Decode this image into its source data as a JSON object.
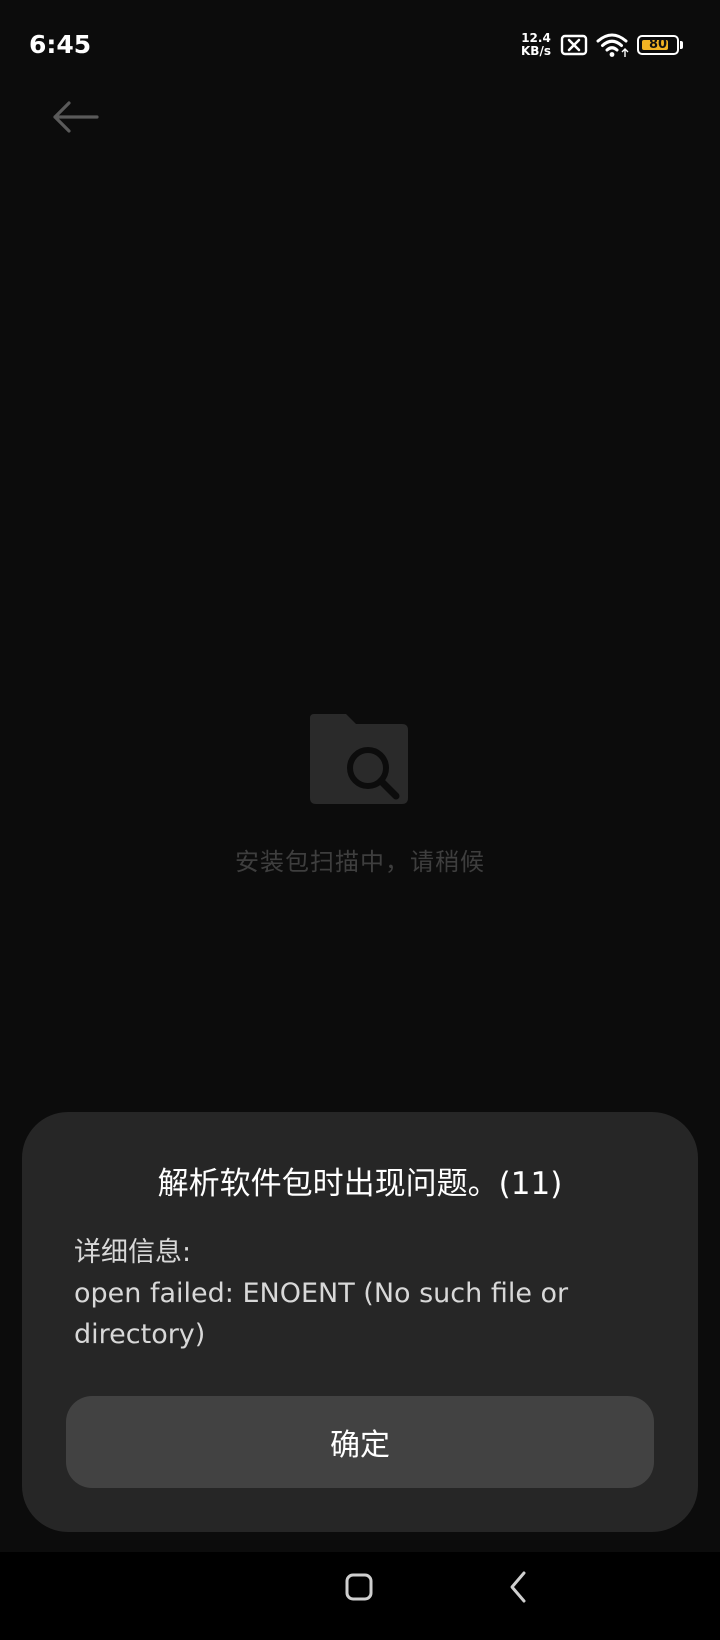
{
  "status_bar": {
    "time": "6:45",
    "net_speed_value": "12.4",
    "net_speed_unit": "KB/s",
    "battery_level": "80",
    "battery_fraction": 0.8,
    "battery_color": "#f2b323",
    "icons": [
      "no-sim-icon",
      "wifi-icon",
      "battery-icon"
    ]
  },
  "toolbar": {
    "back_icon": "back-arrow-icon"
  },
  "empty_state": {
    "icon": "folder-search-icon",
    "message": "安装包扫描中，请稍候"
  },
  "dialog": {
    "title": "解析软件包时出现问题。(11)",
    "detail_label": "详细信息:",
    "detail_message": "open failed: ENOENT (No such file or directory)",
    "confirm_label": "确定"
  },
  "nav_bar": {
    "icons": [
      "home-square-icon",
      "nav-back-icon"
    ]
  }
}
